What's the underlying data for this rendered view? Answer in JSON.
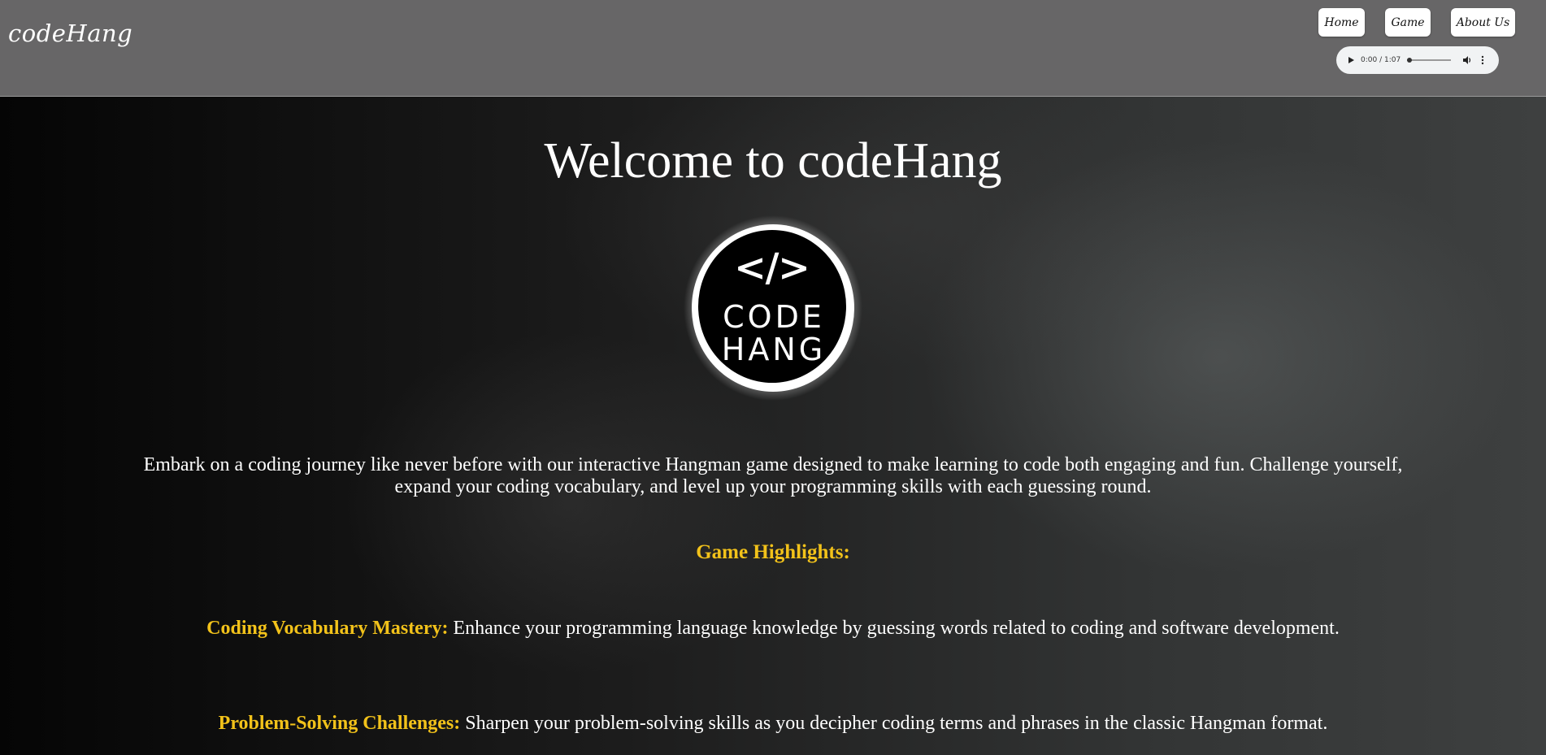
{
  "header": {
    "brand": "codeHang",
    "nav": {
      "home": "Home",
      "game": "Game",
      "about": "About Us"
    },
    "audio": {
      "time": "0:00 / 1:07",
      "progress": 0
    }
  },
  "main": {
    "title": "Welcome to codeHang",
    "logo": {
      "symbol": "</>",
      "line1": "CODE",
      "line2": "HANG"
    },
    "intro": "Embark on a coding journey like never before with our interactive Hangman game designed to make learning to code both engaging and fun. Challenge yourself, expand your coding vocabulary, and level up your programming skills with each guessing round.",
    "highlights_heading": "Game Highlights:",
    "features": [
      {
        "label": "Coding Vocabulary Mastery:",
        "text": " Enhance your programming language knowledge by guessing words related to coding and software development."
      },
      {
        "label": "Problem-Solving Challenges:",
        "text": " Sharpen your problem-solving skills as you decipher coding terms and phrases in the classic Hangman format."
      }
    ]
  },
  "colors": {
    "header_bg": "#676667",
    "highlight": "#f2c21a",
    "text": "#ffffff"
  }
}
